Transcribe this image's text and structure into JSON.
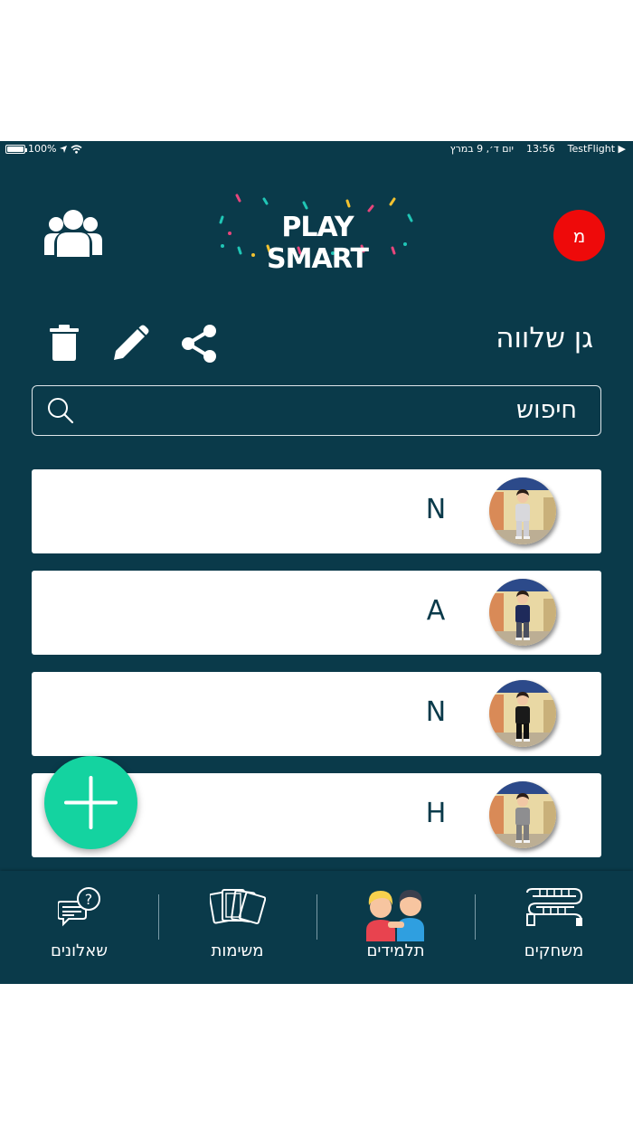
{
  "status_bar": {
    "battery": "100%",
    "time": "13:56",
    "date": "יום ד׳, 9 במרץ",
    "app": "TestFlight ▶"
  },
  "header": {
    "logo_text": "PLAY SMART",
    "avatar_letter": "מ"
  },
  "group": {
    "title": "גן שלווה"
  },
  "search": {
    "placeholder": "חיפוש"
  },
  "students": [
    {
      "name": "N",
      "shirt": "#d8d8dc",
      "pants": "#cfcfd6"
    },
    {
      "name": "A",
      "shirt": "#1e2a5a",
      "pants": "#4a4f5f"
    },
    {
      "name": "N",
      "shirt": "#1a1a1a",
      "pants": "#111111"
    },
    {
      "name": "H",
      "shirt": "#8e8e90",
      "pants": "#7c7c7e"
    }
  ],
  "nav": {
    "games": "משחקים",
    "students": "תלמידים",
    "tasks": "משימות",
    "questionnaires": "שאלונים"
  },
  "colors": {
    "background": "#0a3a4a",
    "accent": "#14d3a0",
    "badge": "#ee0a0a"
  },
  "icons": [
    "users-icon",
    "trash-icon",
    "edit-icon",
    "share-icon",
    "search-icon",
    "plus-icon",
    "board-game-icon",
    "kids-icon",
    "cards-icon",
    "question-chat-icon"
  ]
}
